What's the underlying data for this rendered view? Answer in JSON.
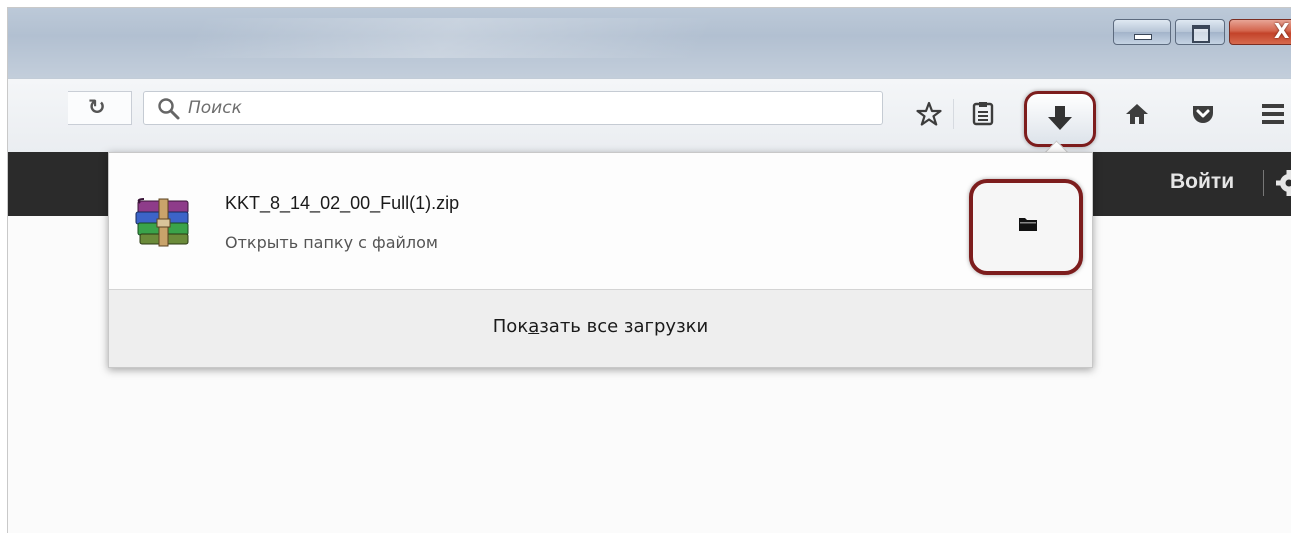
{
  "window": {
    "controls": [
      "minimize",
      "maximize",
      "close"
    ],
    "close_glyph": "X"
  },
  "toolbar": {
    "search": {
      "placeholder": "Поиск"
    },
    "icons": [
      "reload-icon",
      "search-icon",
      "bookmark-star-icon",
      "reading-list-icon",
      "downloads-icon",
      "home-icon",
      "pocket-icon",
      "menu-icon"
    ],
    "highlight_color": "#7d1d1d"
  },
  "page": {
    "login_label": "Войти",
    "bar_color": "#2b2b2b"
  },
  "downloads": {
    "file_name": "KKT_8_14_02_00_Full(1).zip",
    "status_text": "Открыть папку с файлом",
    "show_all_pre": "Пок",
    "show_all_accel": "а",
    "show_all_post": "зать все загрузки",
    "file_icon": "winrar-archive-icon",
    "action_icon": "folder-icon"
  }
}
